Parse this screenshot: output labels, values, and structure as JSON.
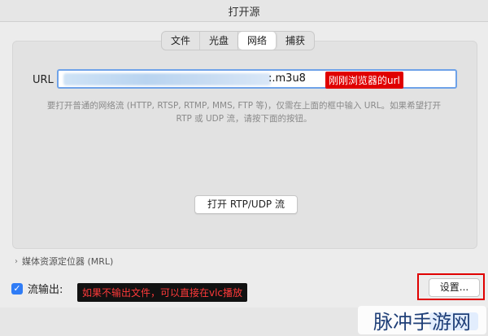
{
  "window": {
    "title": "打开源"
  },
  "tabs": [
    {
      "label": "文件",
      "active": false
    },
    {
      "label": "光盘",
      "active": false
    },
    {
      "label": "网络",
      "active": true
    },
    {
      "label": "捕获",
      "active": false
    }
  ],
  "url_field": {
    "label": "URL",
    "value_visible_tail": ":.m3u8"
  },
  "annotations": {
    "url_note": "刚刚浏览器的url",
    "stream_note": "如果不输出文件，可以直接在vlc播放"
  },
  "hint": {
    "line1": "要打开普通的网络流 (HTTP, RTSP, RTMP, MMS, FTP 等)，仅需在上面的框中输入 URL。如果希望打开",
    "line2": "RTP 或 UDP 流，请按下面的按钮。"
  },
  "rtp_button": {
    "label": "打开 RTP/UDP 流"
  },
  "mrl": {
    "label": "媒体资源定位器 (MRL)"
  },
  "stream_output": {
    "label": "流输出:",
    "checked": true
  },
  "settings_button": {
    "label": "设置..."
  },
  "watermark": {
    "text": "脉冲手游网"
  },
  "colors": {
    "accent": "#2f7cf6",
    "annotation_red": "#e00000"
  }
}
